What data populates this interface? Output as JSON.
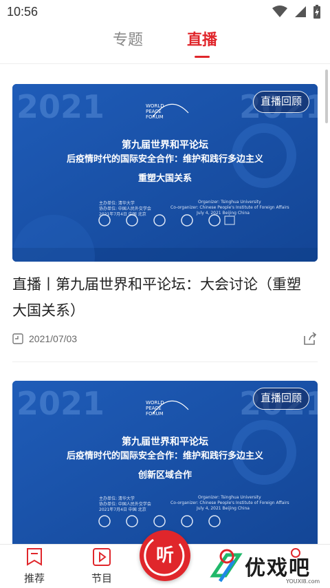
{
  "status_bar": {
    "time": "10:56"
  },
  "tabs": [
    {
      "label": "专题",
      "active": false
    },
    {
      "label": "直播",
      "active": true
    }
  ],
  "cards": [
    {
      "badge": "直播回顾",
      "poster": {
        "year": "2021",
        "logo_lines": [
          "WORLD",
          "PEACE",
          "FORUM"
        ],
        "line1": "第九届世界和平论坛",
        "line2": "后疫情时代的国际安全合作：维护和践行多边主义",
        "line3": "重塑大国关系",
        "org_left": "主办单位: 清华大学",
        "coorg_left": "协办单位: 中国人民外交学会",
        "date_left": "2021年7月4日  中国 北京",
        "org_right": "Organizer: Tsinghua University",
        "coorg_right": "Co-organizer: Chinese People's Institute of Foreign Affairs",
        "date_right": "July 4, 2021   Beijing China"
      },
      "title": "直播丨第九届世界和平论坛：大会讨论（重塑大国关系）",
      "date": "2021/07/03"
    },
    {
      "badge": "直播回顾",
      "poster": {
        "year": "2021",
        "logo_lines": [
          "WORLD",
          "PEACE",
          "FORUM"
        ],
        "line1": "第九届世界和平论坛",
        "line2": "后疫情时代的国际安全合作：维护和践行多边主义",
        "line3": "创新区域合作",
        "org_left": "主办单位: 清华大学",
        "coorg_left": "协办单位: 中国人民外交学会",
        "date_left": "2021年7月4日  中国 北京",
        "org_right": "Organizer: Tsinghua University",
        "coorg_right": "Co-organizer: Chinese People's Institute of Foreign Affairs",
        "date_right": "July 4, 2021   Beijing China"
      }
    }
  ],
  "bottom_nav": {
    "recommend": "推荐",
    "programs": "节目",
    "listen": "听"
  },
  "watermark": {
    "text": "优戏吧",
    "url": "YOUXI8.com"
  },
  "colors": {
    "accent": "#e0262b",
    "poster_blue": "#1a52a8"
  }
}
